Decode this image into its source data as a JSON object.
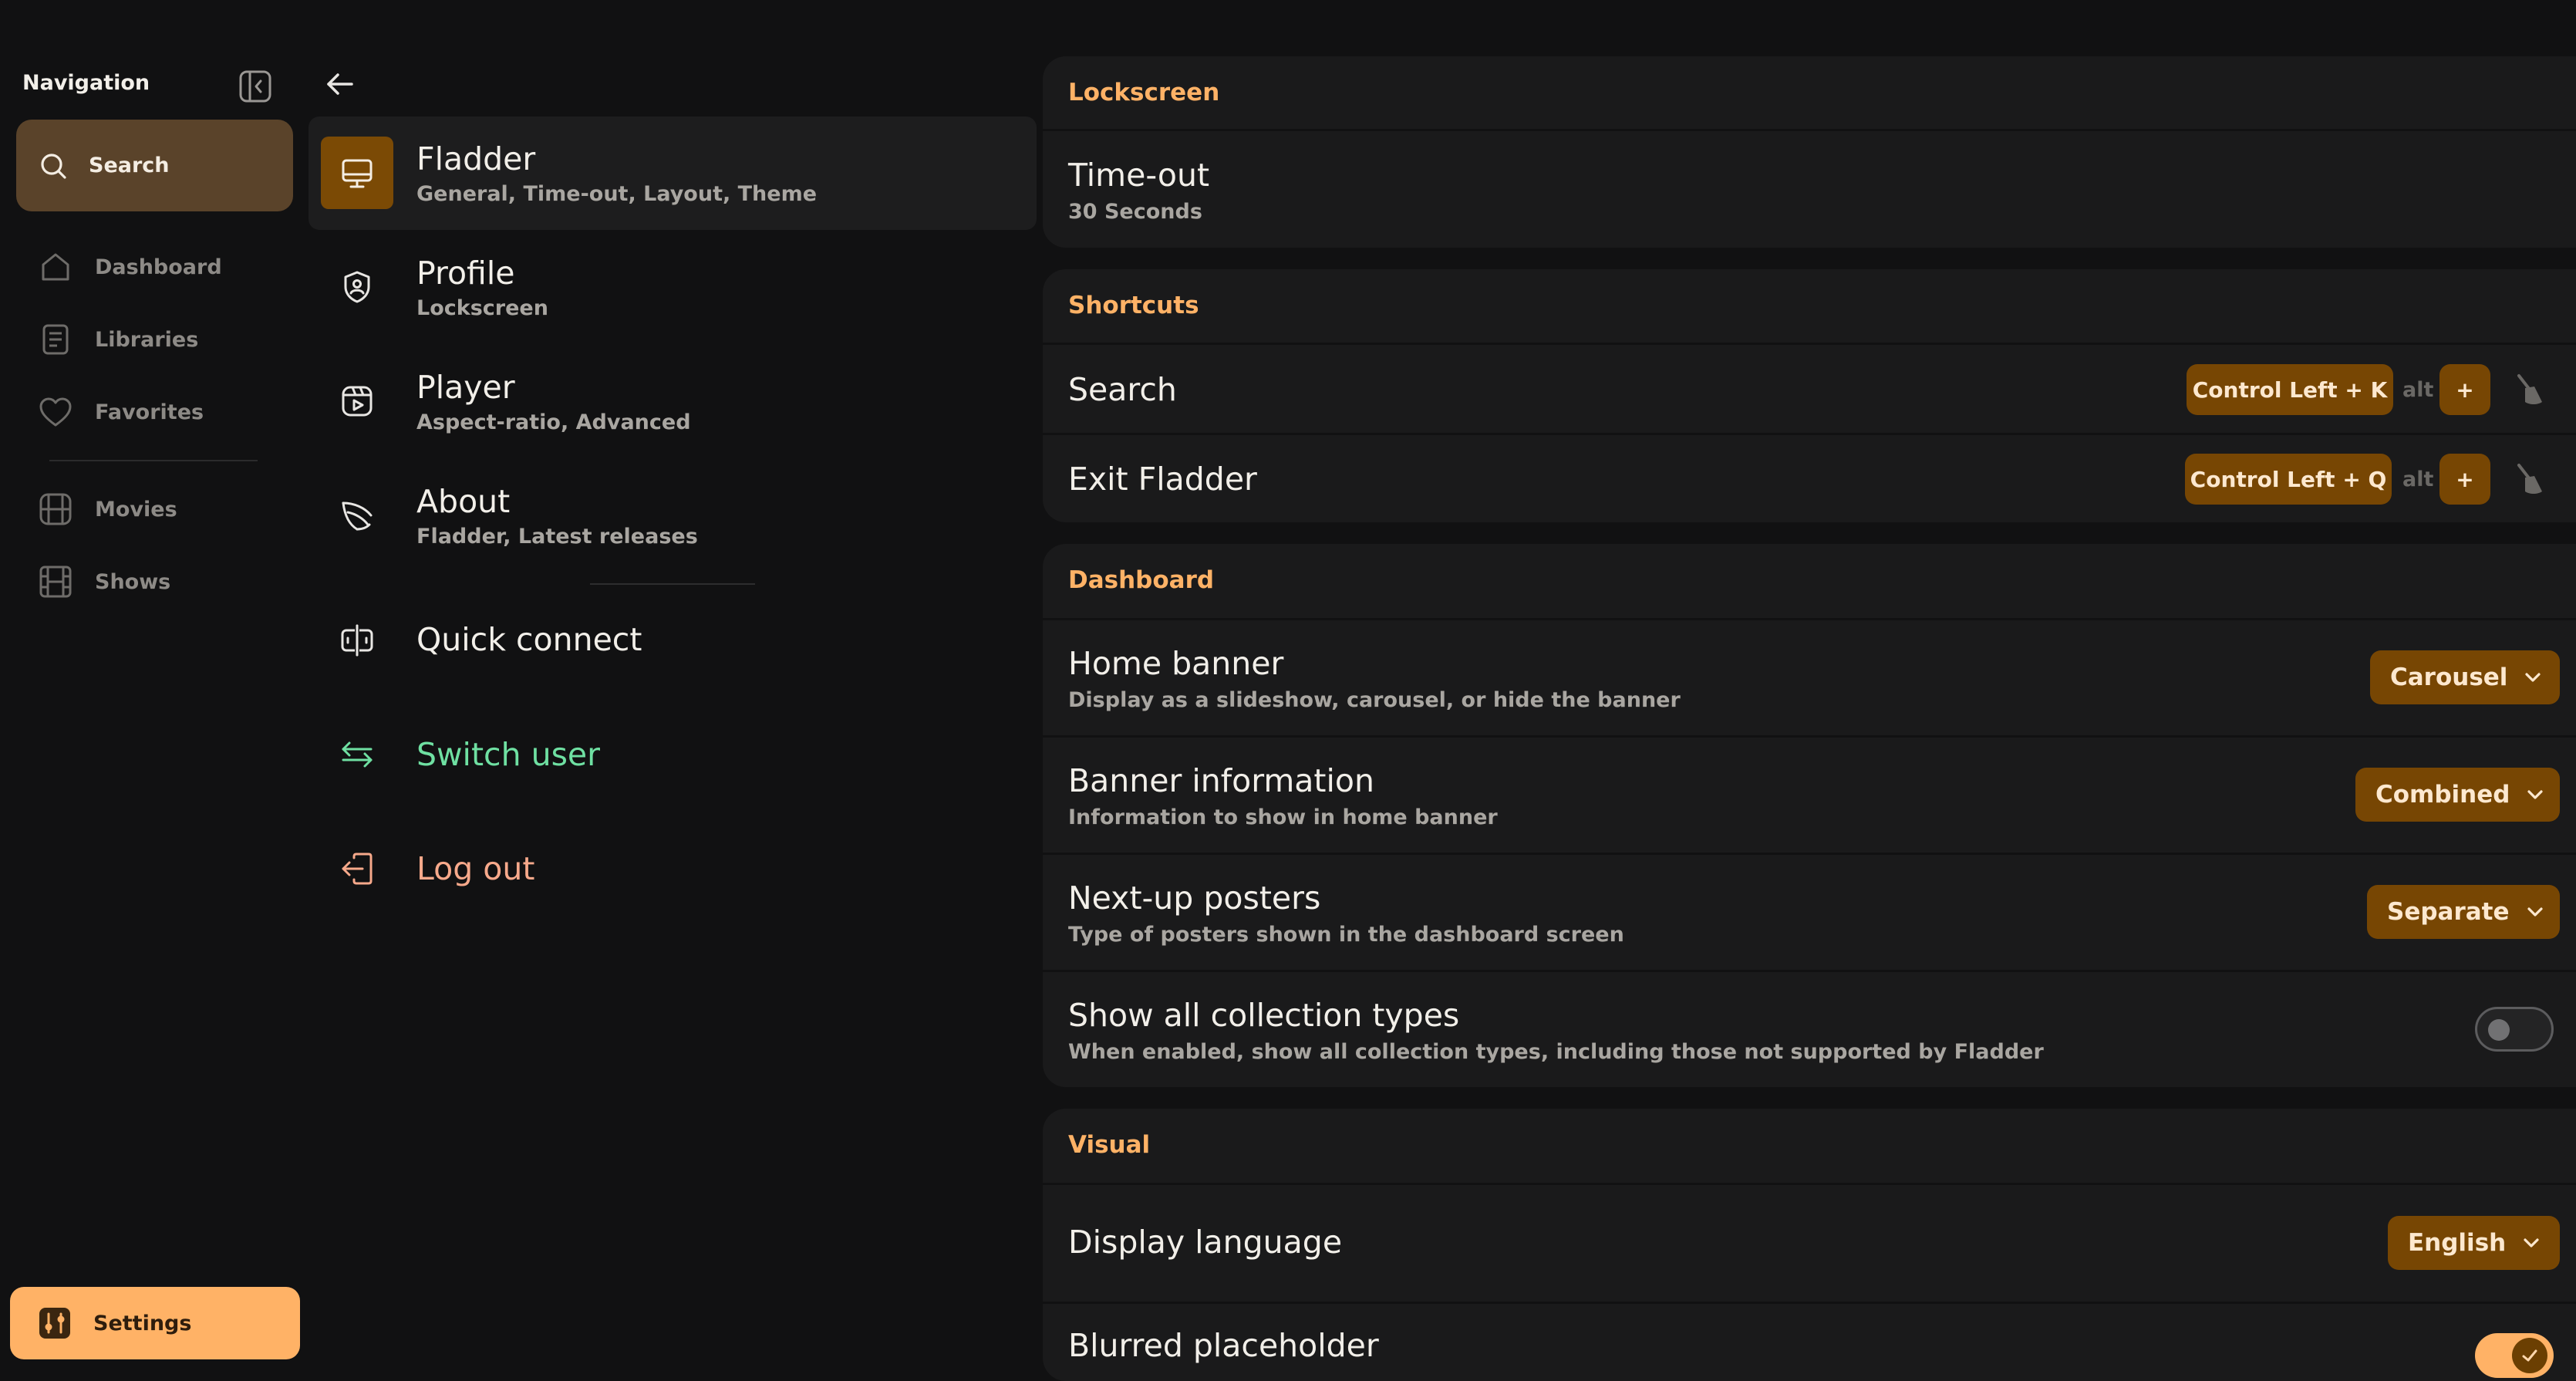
{
  "navigation": {
    "title": "Navigation",
    "search_label": "Search",
    "items": [
      {
        "label": "Dashboard",
        "icon": "home-icon"
      },
      {
        "label": "Libraries",
        "icon": "book-icon"
      },
      {
        "label": "Favorites",
        "icon": "heart-icon"
      },
      {
        "label": "Movies",
        "icon": "film-icon"
      },
      {
        "label": "Shows",
        "icon": "film-strip-icon"
      }
    ],
    "settings_label": "Settings"
  },
  "categories": [
    {
      "title": "Fladder",
      "subtitle": "General, Time-out, Layout, Theme",
      "icon": "monitor-icon",
      "selected": true
    },
    {
      "title": "Profile",
      "subtitle": "Lockscreen",
      "icon": "user-shield-icon"
    },
    {
      "title": "Player",
      "subtitle": "Aspect-ratio, Advanced",
      "icon": "video-icon"
    },
    {
      "title": "About",
      "subtitle": "Fladder, Latest releases",
      "icon": "fladder-logo-icon"
    }
  ],
  "actions": {
    "quick_connect": "Quick connect",
    "switch_user": "Switch user",
    "log_out": "Log out"
  },
  "colors": {
    "accent": "#ffb266",
    "chip": "#774603",
    "switch_user": "#6fe0a2",
    "log_out": "#f7a98b"
  },
  "sections": {
    "lockscreen": {
      "header": "Lockscreen",
      "timeout_title": "Time-out",
      "timeout_value": "30 Seconds"
    },
    "shortcuts": {
      "header": "Shortcuts",
      "search_title": "Search",
      "search_key": "Control Left + K",
      "exit_title": "Exit Fladder",
      "exit_key": "Control Left + Q",
      "alt_label": "alt",
      "add_label": "+"
    },
    "dashboard": {
      "header": "Dashboard",
      "home_banner_title": "Home banner",
      "home_banner_sub": "Display as a slideshow, carousel, or hide the banner",
      "home_banner_value": "Carousel",
      "banner_info_title": "Banner information",
      "banner_info_sub": "Information to show in home banner",
      "banner_info_value": "Combined",
      "nextup_title": "Next-up posters",
      "nextup_sub": "Type of posters shown in the dashboard screen",
      "nextup_value": "Separate",
      "collection_title": "Show all collection types",
      "collection_sub": "When enabled, show all collection types, including those not supported by Fladder",
      "collection_enabled": false
    },
    "visual": {
      "header": "Visual",
      "language_title": "Display language",
      "language_value": "English",
      "blurred_title": "Blurred placeholder",
      "blurred_enabled": true
    }
  }
}
